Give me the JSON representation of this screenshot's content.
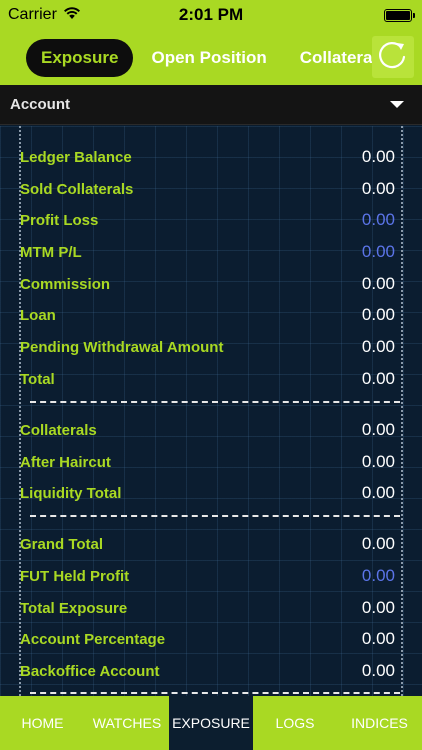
{
  "status_bar": {
    "carrier": "Carrier",
    "time": "2:01 PM"
  },
  "top_tabs": [
    {
      "label": "Exposure",
      "active": true
    },
    {
      "label": "Open Position",
      "active": false
    },
    {
      "label": "Collateral",
      "active": false
    }
  ],
  "account_selector": {
    "label": "Account"
  },
  "rows": [
    {
      "label": "Ledger Balance",
      "value": "0.00"
    },
    {
      "label": "Sold Collaterals",
      "value": "0.00"
    },
    {
      "label": "Profit Loss",
      "value": "0.00"
    },
    {
      "label": "MTM P/L",
      "value": "0.00"
    },
    {
      "label": "Commission",
      "value": "0.00"
    },
    {
      "label": "Loan",
      "value": "0.00"
    },
    {
      "label": "Pending Withdrawal Amount",
      "value": "0.00"
    },
    {
      "label": "Total",
      "value": "0.00"
    },
    {
      "label": "Collaterals",
      "value": "0.00"
    },
    {
      "label": "After Haircut",
      "value": "0.00"
    },
    {
      "label": "Liquidity Total",
      "value": "0.00"
    },
    {
      "label": "Grand Total",
      "value": "0.00"
    },
    {
      "label": "FUT Held Profit",
      "value": "0.00"
    },
    {
      "label": "Total Exposure",
      "value": "0.00"
    },
    {
      "label": "Account Percentage",
      "value": "0.00"
    },
    {
      "label": "Backoffice Account",
      "value": "0.00"
    }
  ],
  "bottom_nav": [
    {
      "label": "HOME",
      "active": false
    },
    {
      "label": "WATCHES",
      "active": false
    },
    {
      "label": "EXPOSURE",
      "active": true
    },
    {
      "label": "LOGS",
      "active": false
    },
    {
      "label": "INDICES",
      "active": false
    }
  ],
  "colors": {
    "accent": "#a9d923",
    "background": "#0b1d30",
    "label": "#a9d923",
    "value": "#ffffff",
    "value_highlight": "#5b74e8"
  },
  "icons": {
    "wifi": "wifi-icon",
    "battery": "battery-icon",
    "refresh": "refresh-icon",
    "dropdown": "chevron-down-icon"
  }
}
